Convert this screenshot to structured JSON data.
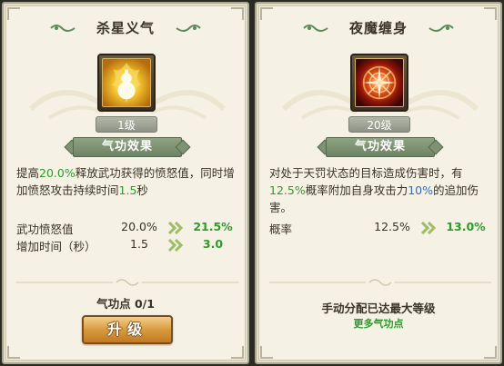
{
  "left_panel": {
    "title": "杀星义气",
    "level": "1级",
    "section_label": "气功效果",
    "desc": {
      "p1": "提高",
      "v1": "20.0%",
      "p2": "释放武功获得的愤怒值，同时增加愤怒攻击持续时间",
      "v2": "1.5",
      "p3": "秒"
    },
    "stats": [
      {
        "label": "武功愤怒值",
        "current": "20.0%",
        "next": "21.5%"
      },
      {
        "label": "增加时间（秒）",
        "current": "1.5",
        "next": "3.0"
      }
    ],
    "points_text": "气功点 0/1",
    "upgrade_label": "升级",
    "icon": "golden-gourd-icon"
  },
  "right_panel": {
    "title": "夜魔缠身",
    "level": "20级",
    "section_label": "气功效果",
    "desc": {
      "p1": "对处于天罚状态的目标造成伤害时，有",
      "v1": "12.5%",
      "p2": "概率附加自身攻击力",
      "v2": "10%",
      "p3": "的追加伤害。"
    },
    "stats": [
      {
        "label": "概率",
        "current": "12.5%",
        "next": "13.0%"
      }
    ],
    "max_text": "手动分配已达最大等级",
    "more_link": "更多气功点",
    "icon": "red-vortex-icon"
  },
  "colors": {
    "panel_bg": "#f5f1e4",
    "highlight_green": "#2e9a2c",
    "highlight_blue": "#2b6fbf",
    "section_green": "#7e9374",
    "upgrade_orange": "#d99a3e"
  }
}
